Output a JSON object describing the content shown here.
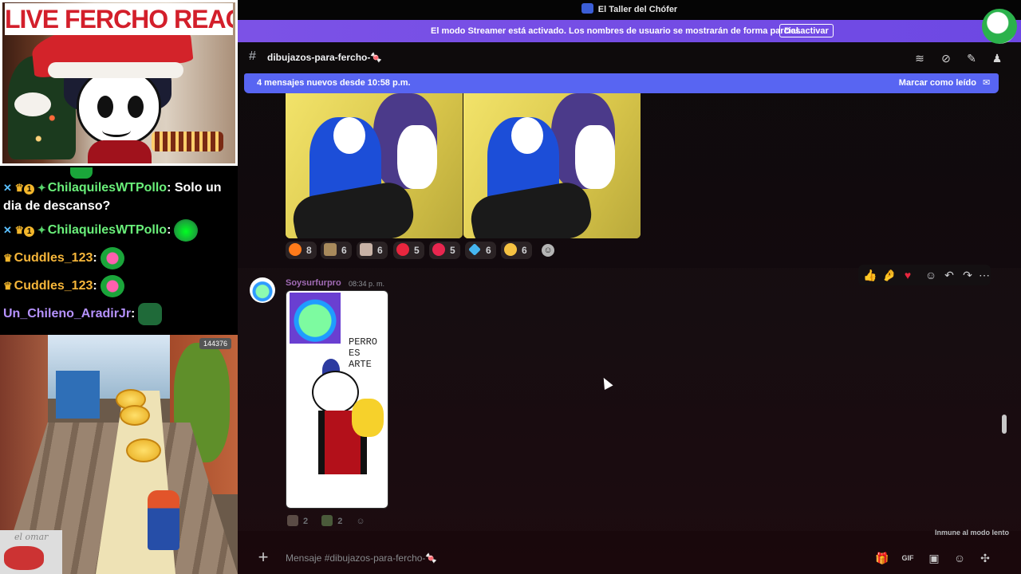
{
  "stream": {
    "title": "LIVE FERCHO REACTION",
    "chat": [
      {
        "badges": [
          "sword",
          "crown",
          "1",
          "diamond"
        ],
        "user": "ChilaquilesWTPollo",
        "text": " Solo un dia de descanso?",
        "emote": null
      },
      {
        "badges": [
          "sword",
          "crown",
          "1",
          "diamond"
        ],
        "user": "ChilaquilesWTPollo",
        "text": "",
        "emote": "green"
      },
      {
        "badges": [
          "crown"
        ],
        "user": "Cuddles_123",
        "text": "",
        "emote": "heart"
      },
      {
        "badges": [
          "crown"
        ],
        "user": "Cuddles_123",
        "text": "",
        "emote": "heart"
      },
      {
        "badges": [],
        "user": "Un_Chileno_AradirJr",
        "text": "",
        "emote": "dark"
      }
    ],
    "game_score": "144376",
    "overlay_logo_text": "el omar"
  },
  "app": {
    "title": "El Taller del Chófer"
  },
  "streamer_mode": {
    "text": "El modo Streamer está activado. Los nombres de usuario se mostrarán de forma parcial.",
    "button": "Desactivar"
  },
  "channel": {
    "hash": "#",
    "name": "dibujazos-para-fercho-🍬",
    "header_icons": [
      "threads-icon",
      "mute-icon",
      "pin-icon",
      "members-icon"
    ]
  },
  "new_messages": {
    "text": "4 mensajes nuevos desde 10:58 p.m.",
    "mark_read": "Marcar como leído"
  },
  "reactions": [
    {
      "emoji": "fire",
      "count": "8",
      "color": "#ff7a1a"
    },
    {
      "emoji": "sticker-a",
      "count": "6",
      "color": "#a88a5c"
    },
    {
      "emoji": "sticker-b",
      "count": "6",
      "color": "#c8b2a6"
    },
    {
      "emoji": "heart",
      "count": "5",
      "color": "#e8263e"
    },
    {
      "emoji": "sparkle-heart",
      "count": "5",
      "color": "#e8264f"
    },
    {
      "emoji": "diamond",
      "count": "6",
      "color": "#45b6f0"
    },
    {
      "emoji": "sparkles",
      "count": "6",
      "color": "#f5c242"
    }
  ],
  "message": {
    "username": "Soysurfurpro",
    "timestamp": "08:34 p. m.",
    "drawing_text": "PERRO ES ARTE",
    "reactions": [
      {
        "emoji": "sticker-c",
        "count": "2"
      },
      {
        "emoji": "sticker-d",
        "count": "2"
      }
    ]
  },
  "message_toolbar": [
    "thumbs-up-icon",
    "pinch-icon",
    "heart-icon",
    "add-reaction-icon",
    "reply-icon",
    "forward-icon",
    "more-icon"
  ],
  "slow_mode": "Inmune al modo lento",
  "composer": {
    "placeholder": "Mensaje #dibujazos-para-fercho-🍬",
    "icons": [
      "gift-icon",
      "gif-icon",
      "sticker-icon",
      "emoji-icon",
      "apps-icon"
    ]
  }
}
